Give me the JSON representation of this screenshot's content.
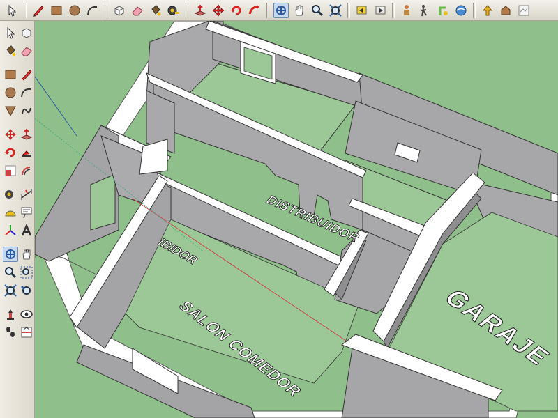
{
  "app": {
    "accent_color": "#2c5aa0",
    "ground_color": "#8fbf8a",
    "wall_color": "#a9a9ab",
    "slab_color": "#ffffff"
  },
  "toolbar_top": {
    "buttons": [
      "select-icon",
      "pencil-line-icon",
      "rectangle-icon",
      "circle-icon",
      "arc-icon",
      "make-component-icon",
      "eraser-icon",
      "paint-bucket-icon",
      "tape-measure-icon",
      "push-pull-icon",
      "move-icon",
      "rotate-icon",
      "follow-me-icon",
      "orbit-icon",
      "pan-icon",
      "zoom-icon",
      "zoom-extents-icon",
      "previous-view-icon",
      "next-view-icon",
      "position-camera-icon",
      "walk-icon",
      "look-around-icon",
      "section-plane-icon",
      "get-models-icon",
      "share-model-icon",
      "google-earth-icon"
    ]
  },
  "toolbar_left": {
    "buttons": [
      "select-icon",
      "make-component-icon",
      "paint-bucket-icon",
      "eraser-icon",
      "rectangle-icon",
      "pencil-line-icon",
      "circle-icon",
      "arc-icon",
      "polygon-icon",
      "freehand-icon",
      "move-icon",
      "push-pull-icon",
      "rotate-icon",
      "follow-me-icon",
      "scale-icon",
      "offset-icon",
      "tape-measure-icon",
      "dimension-icon",
      "protractor-icon",
      "text-icon",
      "axes-icon",
      "3d-text-icon",
      "orbit-icon",
      "pan-icon",
      "zoom-icon",
      "zoom-window-icon",
      "zoom-extents-icon",
      "previous-view-icon",
      "position-camera-icon",
      "look-around-icon",
      "walk-icon",
      "section-plane-icon"
    ]
  },
  "rooms": {
    "salon": "SALON COMEDOR",
    "distribuidor": "DISTRIBUIDOR",
    "garaje": "GARAJE",
    "partial": "IBIDOR"
  }
}
